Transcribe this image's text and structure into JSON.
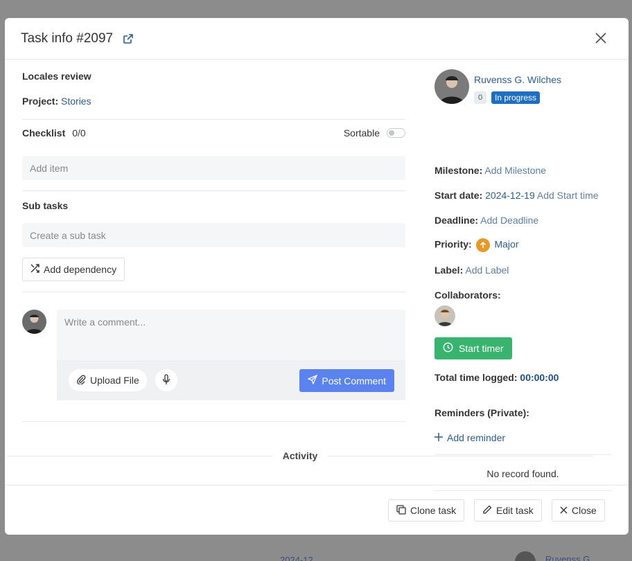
{
  "modal": {
    "title": "Task info #2097",
    "task_title": "Locales review",
    "project_label": "Project:",
    "project_value": "Stories",
    "checklist_label": "Checklist",
    "checklist_count": "0/0",
    "sortable_label": "Sortable",
    "add_item_placeholder": "Add item",
    "subtasks_label": "Sub tasks",
    "subtask_placeholder": "Create a sub task",
    "add_dependency_label": "Add dependency",
    "comment_placeholder": "Write a comment...",
    "upload_file_label": "Upload File",
    "post_comment_label": "Post Comment",
    "activity_label": "Activity"
  },
  "sidebar": {
    "user_name": "Ruvenss G. Wilches",
    "badge_count": "0",
    "status": "In progress",
    "milestone_label": "Milestone:",
    "milestone_value": "Add Milestone",
    "start_date_label": "Start date:",
    "start_date_value": "2024-12-19",
    "start_time_value": "Add Start time",
    "deadline_label": "Deadline:",
    "deadline_value": "Add Deadline",
    "priority_label": "Priority:",
    "priority_value": "Major",
    "label_label": "Label:",
    "label_value": "Add Label",
    "collaborators_label": "Collaborators:",
    "start_timer_label": "Start timer",
    "total_time_label": "Total time logged:",
    "total_time_value": "00:00:00",
    "reminders_label": "Reminders (Private):",
    "add_reminder_label": "Add reminder",
    "no_record_text": "No record found."
  },
  "footer": {
    "clone_label": "Clone task",
    "edit_label": "Edit task",
    "close_label": "Close"
  },
  "background": {
    "date_fragment": "2024-12",
    "user_fragment": "Ruvenss G."
  },
  "colors": {
    "accent_blue": "#5b83ef",
    "status_blue": "#1f6fc0",
    "timer_green": "#38b46f",
    "priority_orange": "#e39a2a",
    "link": "#2e5c8a"
  }
}
